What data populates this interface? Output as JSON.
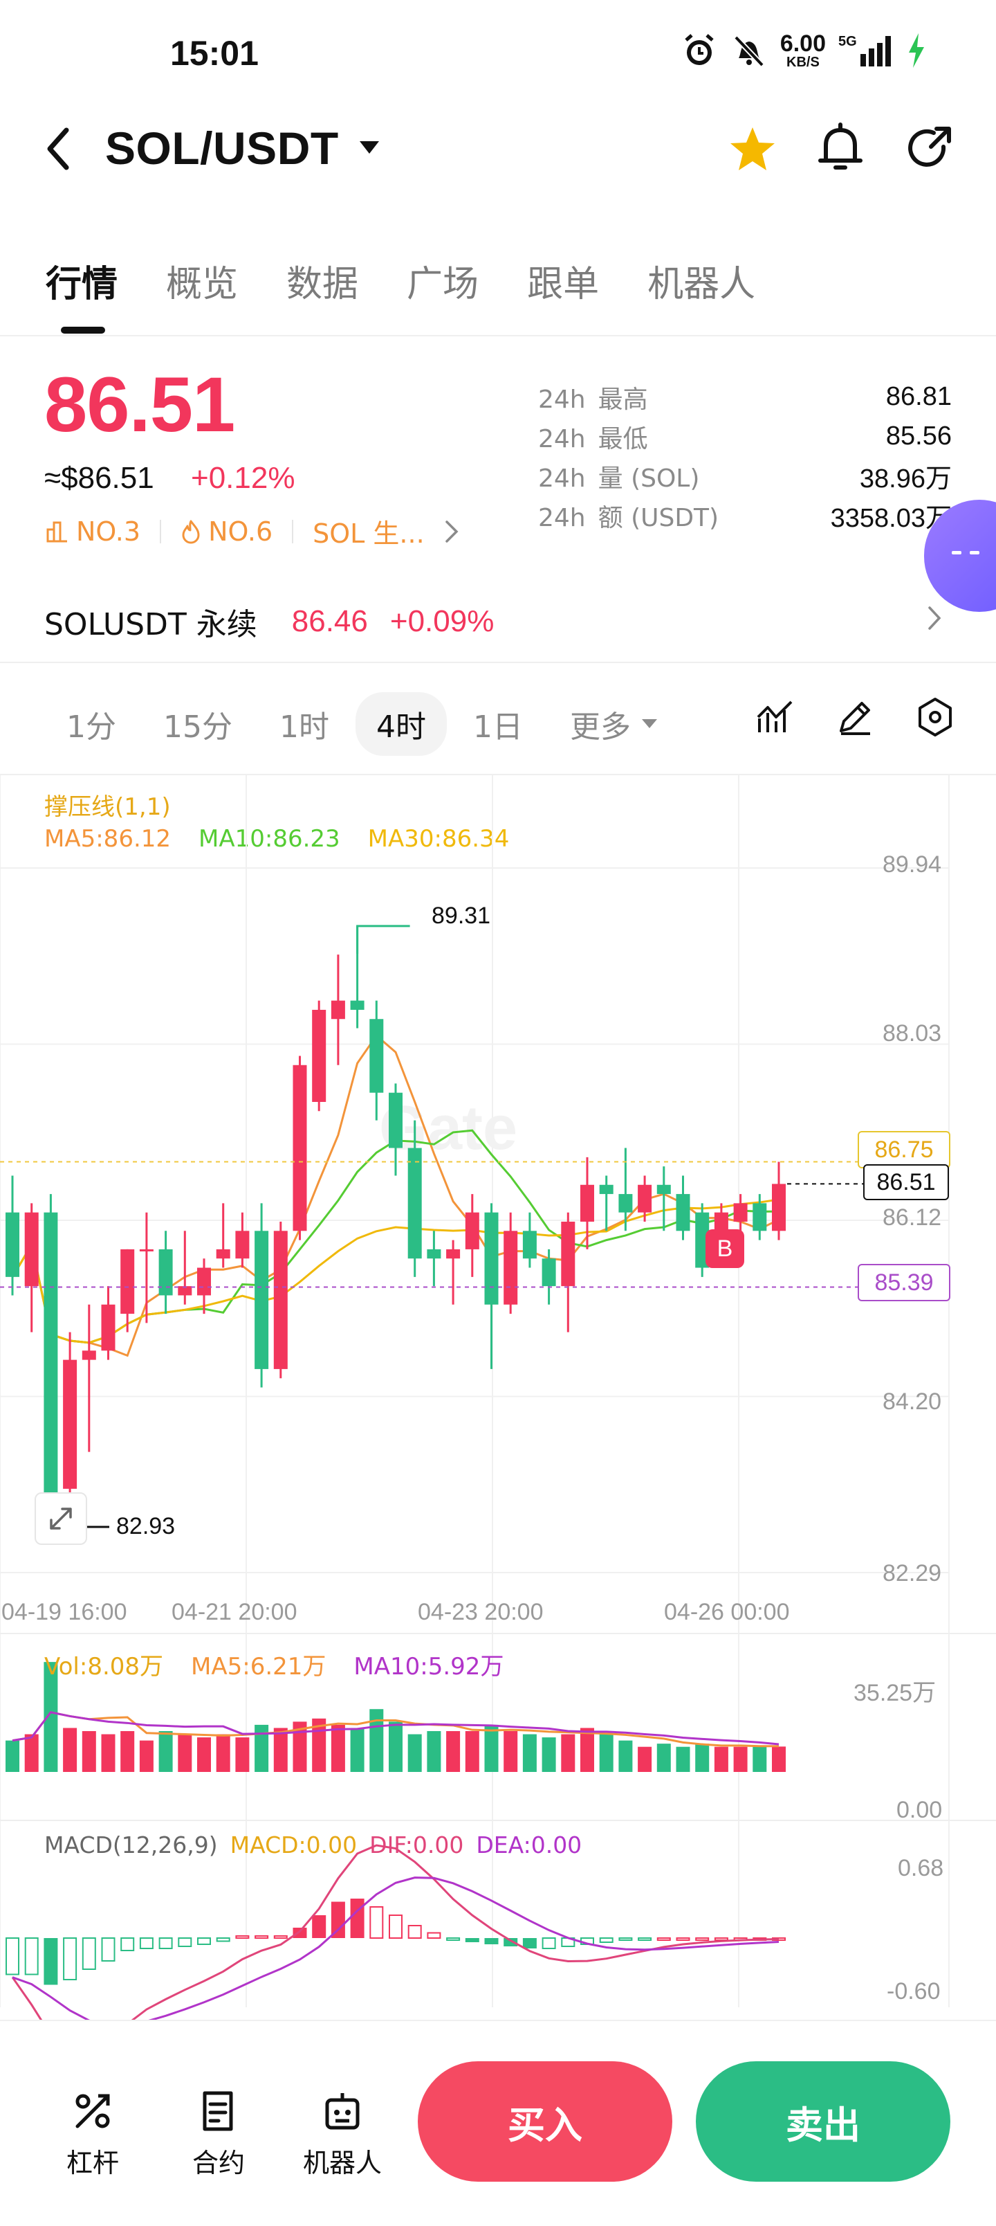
{
  "status": {
    "time": "15:01",
    "net_speed": "6.00",
    "net_unit": "KB/S",
    "network": "5G"
  },
  "header": {
    "pair": "SOL/USDT"
  },
  "tabs": [
    "行情",
    "概览",
    "数据",
    "广场",
    "跟单",
    "机器人"
  ],
  "price": {
    "last": "86.51",
    "usd": "≈$86.51",
    "change": "+0.12%",
    "rank1": "NO.3",
    "rank2": "NO.6",
    "tag": "SOL 生..."
  },
  "stats": [
    {
      "period": "24h",
      "label": "最高",
      "value": "86.81"
    },
    {
      "period": "24h",
      "label": "最低",
      "value": "85.56"
    },
    {
      "period": "24h",
      "label": "量 (SOL)",
      "value": "38.96万"
    },
    {
      "period": "24h",
      "label": "额 (USDT)",
      "value": "3358.03万"
    }
  ],
  "perp": {
    "name": "SOLUSDT 永续",
    "price": "86.46",
    "change": "+0.09%"
  },
  "intervals": [
    "1分",
    "15分",
    "1时",
    "4时",
    "1日",
    "更多"
  ],
  "legend": {
    "indicator": "撑压线(1,1)",
    "ma5": "MA5:86.12",
    "ma10": "MA10:86.23",
    "ma30": "MA30:86.34"
  },
  "chart_labels": {
    "y_ticks": [
      "89.94",
      "88.03",
      "86.12",
      "84.20",
      "82.29"
    ],
    "x_ticks": [
      "04-19 16:00",
      "04-21 20:00",
      "04-23 20:00",
      "04-26 00:00"
    ],
    "high_marker": "89.31",
    "low_marker": "82.93",
    "resistance": "86.75",
    "support": "85.39",
    "current": "86.51",
    "buy_marker": "B",
    "watermark": "Gate"
  },
  "volume": {
    "vol": "Vol:8.08万",
    "ma5": "MA5:6.21万",
    "ma10": "MA10:5.92万",
    "max": "35.25万",
    "min": "0.00"
  },
  "macd": {
    "title": "MACD(12,26,9)",
    "macd": "MACD:0.00",
    "dif": "DIF:0.00",
    "dea": "DEA:0.00",
    "max": "0.68",
    "min": "-0.60"
  },
  "bottom_nav": [
    "杠杆",
    "合约",
    "机器人"
  ],
  "buy_label": "买入",
  "sell_label": "卖出",
  "colors": {
    "up": "#f2365c",
    "down": "#2bbd85",
    "ma5": "#f3943a",
    "ma10": "#55cc33",
    "ma30": "#f0b90b",
    "vol_ma10": "#b134c9"
  },
  "chart_data": {
    "type": "candlestick",
    "ylim": [
      82.29,
      89.94
    ],
    "candles": [
      {
        "o": 86.2,
        "c": 85.5,
        "h": 86.6,
        "l": 85.3
      },
      {
        "o": 85.4,
        "c": 86.2,
        "h": 86.3,
        "l": 84.9
      },
      {
        "o": 86.2,
        "c": 82.93,
        "h": 86.4,
        "l": 82.93
      },
      {
        "o": 83.2,
        "c": 84.6,
        "h": 84.9,
        "l": 83.1
      },
      {
        "o": 84.6,
        "c": 84.7,
        "h": 85.2,
        "l": 83.6
      },
      {
        "o": 84.7,
        "c": 85.2,
        "h": 85.4,
        "l": 84.6
      },
      {
        "o": 85.1,
        "c": 85.8,
        "h": 85.8,
        "l": 84.9
      },
      {
        "o": 85.8,
        "c": 85.8,
        "h": 86.2,
        "l": 85.0
      },
      {
        "o": 85.8,
        "c": 85.3,
        "h": 86.0,
        "l": 85.1
      },
      {
        "o": 85.3,
        "c": 85.4,
        "h": 86.0,
        "l": 85.2
      },
      {
        "o": 85.3,
        "c": 85.6,
        "h": 85.7,
        "l": 85.1
      },
      {
        "o": 85.7,
        "c": 85.8,
        "h": 86.3,
        "l": 85.6
      },
      {
        "o": 85.7,
        "c": 86.0,
        "h": 86.2,
        "l": 85.6
      },
      {
        "o": 86.0,
        "c": 84.5,
        "h": 86.3,
        "l": 84.3
      },
      {
        "o": 84.5,
        "c": 86.0,
        "h": 86.1,
        "l": 84.4
      },
      {
        "o": 86.0,
        "c": 87.8,
        "h": 87.9,
        "l": 85.9
      },
      {
        "o": 87.4,
        "c": 88.4,
        "h": 88.5,
        "l": 87.3
      },
      {
        "o": 88.3,
        "c": 88.5,
        "h": 89.0,
        "l": 87.8
      },
      {
        "o": 88.5,
        "c": 88.4,
        "h": 89.31,
        "l": 88.2
      },
      {
        "o": 88.3,
        "c": 87.5,
        "h": 88.5,
        "l": 87.2
      },
      {
        "o": 87.5,
        "c": 86.9,
        "h": 87.6,
        "l": 86.6
      },
      {
        "o": 86.9,
        "c": 85.7,
        "h": 87.2,
        "l": 85.5
      },
      {
        "o": 85.8,
        "c": 85.7,
        "h": 86.0,
        "l": 85.4
      },
      {
        "o": 85.7,
        "c": 85.8,
        "h": 85.9,
        "l": 85.2
      },
      {
        "o": 85.8,
        "c": 86.2,
        "h": 86.4,
        "l": 85.5
      },
      {
        "o": 86.2,
        "c": 85.2,
        "h": 86.3,
        "l": 84.5
      },
      {
        "o": 85.2,
        "c": 86.0,
        "h": 86.2,
        "l": 85.1
      },
      {
        "o": 86.0,
        "c": 85.7,
        "h": 86.2,
        "l": 85.6
      },
      {
        "o": 85.7,
        "c": 85.4,
        "h": 85.8,
        "l": 85.2
      },
      {
        "o": 85.4,
        "c": 86.1,
        "h": 86.2,
        "l": 84.9
      },
      {
        "o": 86.1,
        "c": 86.5,
        "h": 86.8,
        "l": 85.8
      },
      {
        "o": 86.5,
        "c": 86.4,
        "h": 86.6,
        "l": 86.0
      },
      {
        "o": 86.4,
        "c": 86.2,
        "h": 86.9,
        "l": 86.0
      },
      {
        "o": 86.2,
        "c": 86.5,
        "h": 86.6,
        "l": 86.1
      },
      {
        "o": 86.5,
        "c": 86.4,
        "h": 86.7,
        "l": 86.0
      },
      {
        "o": 86.4,
        "c": 86.0,
        "h": 86.6,
        "l": 85.9
      },
      {
        "o": 86.2,
        "c": 85.6,
        "h": 86.3,
        "l": 85.5
      },
      {
        "o": 85.7,
        "c": 86.2,
        "h": 86.3,
        "l": 85.6
      },
      {
        "o": 86.1,
        "c": 86.3,
        "h": 86.4,
        "l": 85.9
      },
      {
        "o": 86.3,
        "c": 86.0,
        "h": 86.4,
        "l": 85.9
      },
      {
        "o": 86.0,
        "c": 86.51,
        "h": 86.75,
        "l": 85.9
      }
    ],
    "volume": [
      10,
      12,
      35,
      14,
      13,
      12,
      13,
      10,
      13,
      12,
      11,
      12,
      11,
      15,
      14,
      16,
      17,
      15,
      14,
      20,
      16,
      12,
      13,
      13,
      13,
      15,
      13,
      12,
      11,
      12,
      14,
      12,
      10,
      8,
      9,
      8,
      9,
      8,
      8,
      8,
      8.08
    ],
    "macd_hist": [
      -0.35,
      -0.35,
      -0.45,
      -0.4,
      -0.3,
      -0.22,
      -0.12,
      -0.1,
      -0.1,
      -0.08,
      -0.06,
      -0.03,
      0.02,
      0.02,
      0.02,
      0.1,
      0.22,
      0.35,
      0.38,
      0.3,
      0.22,
      0.12,
      0.05,
      -0.02,
      -0.04,
      -0.06,
      -0.08,
      -0.1,
      -0.1,
      -0.08,
      -0.06,
      -0.04,
      -0.02,
      -0.01,
      0,
      0,
      0,
      0,
      0,
      0,
      0
    ]
  }
}
